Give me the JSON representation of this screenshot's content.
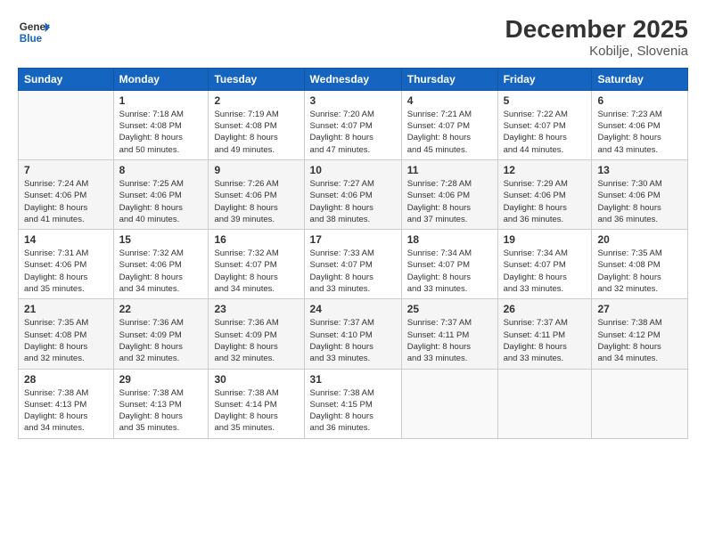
{
  "header": {
    "logo_general": "General",
    "logo_blue": "Blue",
    "title": "December 2025",
    "subtitle": "Kobilje, Slovenia"
  },
  "calendar": {
    "columns": [
      "Sunday",
      "Monday",
      "Tuesday",
      "Wednesday",
      "Thursday",
      "Friday",
      "Saturday"
    ],
    "weeks": [
      [
        {
          "day": "",
          "info": ""
        },
        {
          "day": "1",
          "info": "Sunrise: 7:18 AM\nSunset: 4:08 PM\nDaylight: 8 hours\nand 50 minutes."
        },
        {
          "day": "2",
          "info": "Sunrise: 7:19 AM\nSunset: 4:08 PM\nDaylight: 8 hours\nand 49 minutes."
        },
        {
          "day": "3",
          "info": "Sunrise: 7:20 AM\nSunset: 4:07 PM\nDaylight: 8 hours\nand 47 minutes."
        },
        {
          "day": "4",
          "info": "Sunrise: 7:21 AM\nSunset: 4:07 PM\nDaylight: 8 hours\nand 45 minutes."
        },
        {
          "day": "5",
          "info": "Sunrise: 7:22 AM\nSunset: 4:07 PM\nDaylight: 8 hours\nand 44 minutes."
        },
        {
          "day": "6",
          "info": "Sunrise: 7:23 AM\nSunset: 4:06 PM\nDaylight: 8 hours\nand 43 minutes."
        }
      ],
      [
        {
          "day": "7",
          "info": "Sunrise: 7:24 AM\nSunset: 4:06 PM\nDaylight: 8 hours\nand 41 minutes."
        },
        {
          "day": "8",
          "info": "Sunrise: 7:25 AM\nSunset: 4:06 PM\nDaylight: 8 hours\nand 40 minutes."
        },
        {
          "day": "9",
          "info": "Sunrise: 7:26 AM\nSunset: 4:06 PM\nDaylight: 8 hours\nand 39 minutes."
        },
        {
          "day": "10",
          "info": "Sunrise: 7:27 AM\nSunset: 4:06 PM\nDaylight: 8 hours\nand 38 minutes."
        },
        {
          "day": "11",
          "info": "Sunrise: 7:28 AM\nSunset: 4:06 PM\nDaylight: 8 hours\nand 37 minutes."
        },
        {
          "day": "12",
          "info": "Sunrise: 7:29 AM\nSunset: 4:06 PM\nDaylight: 8 hours\nand 36 minutes."
        },
        {
          "day": "13",
          "info": "Sunrise: 7:30 AM\nSunset: 4:06 PM\nDaylight: 8 hours\nand 36 minutes."
        }
      ],
      [
        {
          "day": "14",
          "info": "Sunrise: 7:31 AM\nSunset: 4:06 PM\nDaylight: 8 hours\nand 35 minutes."
        },
        {
          "day": "15",
          "info": "Sunrise: 7:32 AM\nSunset: 4:06 PM\nDaylight: 8 hours\nand 34 minutes."
        },
        {
          "day": "16",
          "info": "Sunrise: 7:32 AM\nSunset: 4:07 PM\nDaylight: 8 hours\nand 34 minutes."
        },
        {
          "day": "17",
          "info": "Sunrise: 7:33 AM\nSunset: 4:07 PM\nDaylight: 8 hours\nand 33 minutes."
        },
        {
          "day": "18",
          "info": "Sunrise: 7:34 AM\nSunset: 4:07 PM\nDaylight: 8 hours\nand 33 minutes."
        },
        {
          "day": "19",
          "info": "Sunrise: 7:34 AM\nSunset: 4:07 PM\nDaylight: 8 hours\nand 33 minutes."
        },
        {
          "day": "20",
          "info": "Sunrise: 7:35 AM\nSunset: 4:08 PM\nDaylight: 8 hours\nand 32 minutes."
        }
      ],
      [
        {
          "day": "21",
          "info": "Sunrise: 7:35 AM\nSunset: 4:08 PM\nDaylight: 8 hours\nand 32 minutes."
        },
        {
          "day": "22",
          "info": "Sunrise: 7:36 AM\nSunset: 4:09 PM\nDaylight: 8 hours\nand 32 minutes."
        },
        {
          "day": "23",
          "info": "Sunrise: 7:36 AM\nSunset: 4:09 PM\nDaylight: 8 hours\nand 32 minutes."
        },
        {
          "day": "24",
          "info": "Sunrise: 7:37 AM\nSunset: 4:10 PM\nDaylight: 8 hours\nand 33 minutes."
        },
        {
          "day": "25",
          "info": "Sunrise: 7:37 AM\nSunset: 4:11 PM\nDaylight: 8 hours\nand 33 minutes."
        },
        {
          "day": "26",
          "info": "Sunrise: 7:37 AM\nSunset: 4:11 PM\nDaylight: 8 hours\nand 33 minutes."
        },
        {
          "day": "27",
          "info": "Sunrise: 7:38 AM\nSunset: 4:12 PM\nDaylight: 8 hours\nand 34 minutes."
        }
      ],
      [
        {
          "day": "28",
          "info": "Sunrise: 7:38 AM\nSunset: 4:13 PM\nDaylight: 8 hours\nand 34 minutes."
        },
        {
          "day": "29",
          "info": "Sunrise: 7:38 AM\nSunset: 4:13 PM\nDaylight: 8 hours\nand 35 minutes."
        },
        {
          "day": "30",
          "info": "Sunrise: 7:38 AM\nSunset: 4:14 PM\nDaylight: 8 hours\nand 35 minutes."
        },
        {
          "day": "31",
          "info": "Sunrise: 7:38 AM\nSunset: 4:15 PM\nDaylight: 8 hours\nand 36 minutes."
        },
        {
          "day": "",
          "info": ""
        },
        {
          "day": "",
          "info": ""
        },
        {
          "day": "",
          "info": ""
        }
      ]
    ]
  }
}
